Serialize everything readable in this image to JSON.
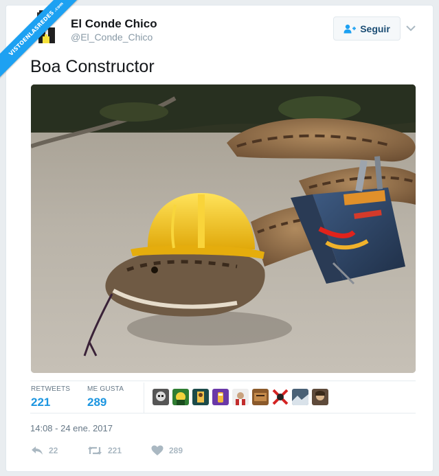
{
  "watermark": {
    "text": "VISTOENLASREDES",
    "suffix": ".com"
  },
  "author": {
    "name": "El Conde Chico",
    "handle": "@El_Conde_Chico"
  },
  "follow_button": {
    "label": "Seguir",
    "icon": "add-user-icon"
  },
  "more_menu": {
    "icon": "chevron-down-icon"
  },
  "tweet": {
    "text": "Boa Constructor"
  },
  "photo": {
    "description_icon": "snake-hardhat-toolbelt-photo"
  },
  "stats": {
    "retweets_label": "RETWEETS",
    "retweets_value": "221",
    "likes_label": "ME GUSTA",
    "likes_value": "289",
    "likers_count": 9
  },
  "timestamp": "14:08 - 24 ene. 2017",
  "actions": {
    "reply_count": "22",
    "retweet_count": "221",
    "like_count": "289"
  },
  "colors": {
    "accent": "#1da1f2",
    "stat_value": "#1b95e0",
    "follow_text": "#1b4d74",
    "muted": "#aab8c2",
    "hardhat": "#f2c318"
  }
}
